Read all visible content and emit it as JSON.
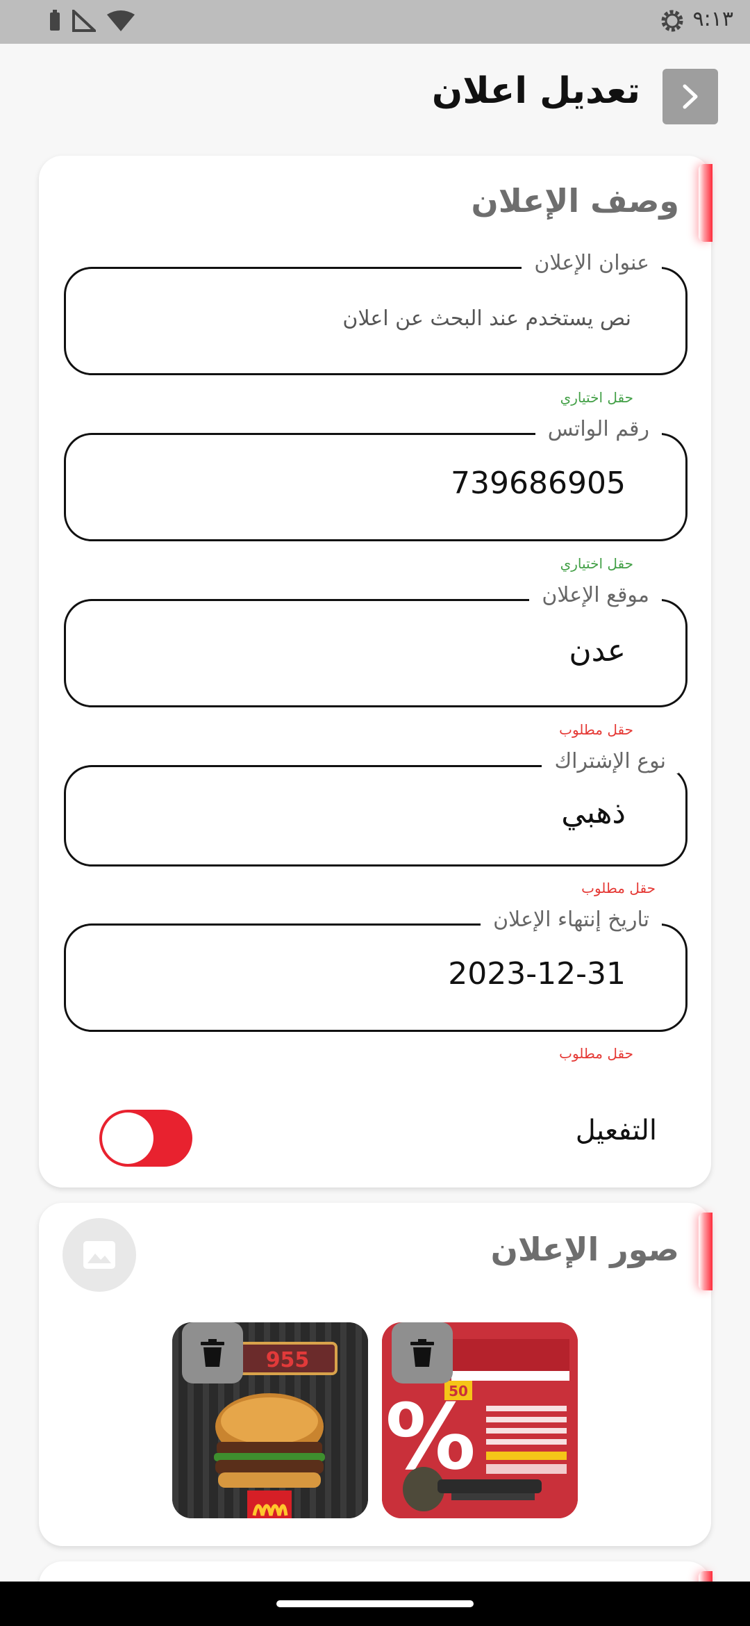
{
  "status_bar": {
    "time": "٩:١٣",
    "icons": [
      "battery-icon",
      "signal-icon",
      "wifi-icon",
      "settings-gear-icon"
    ]
  },
  "header": {
    "title": "تعديل  اعلان",
    "back_icon": "chevron-right-icon"
  },
  "ad_description": {
    "section_title": "وصف الإعلان",
    "title_field": {
      "label": "عنوان الإعلان",
      "placeholder": "نص يستخدم عند البحث عن اعلان",
      "hint": "حقل اختياري"
    },
    "whatsapp_field": {
      "label": "رقم الواتس",
      "value": "739686905",
      "hint": "حقل اختياري"
    },
    "location_field": {
      "label": "موقع الإعلان",
      "value": "عدن",
      "hint": "حقل مطلوب"
    },
    "subscription_field": {
      "label": "نوع الإشتراك",
      "value": "ذهبي",
      "hint": "حقل مطلوب"
    },
    "expiry_field": {
      "label": "تاريخ إنتهاء الإعلان",
      "value": "2023-12-31",
      "hint": "حقل مطلوب"
    },
    "activation": {
      "label": "التفعيل",
      "enabled": true
    }
  },
  "ad_images": {
    "section_title": "صور الإعلان",
    "add_icon": "image-icon",
    "images": [
      {
        "name": "burger-ad-image",
        "delete_icon": "trash-icon"
      },
      {
        "name": "discount-ad-image",
        "delete_icon": "trash-icon"
      }
    ]
  },
  "colors": {
    "accent": "#e8222f",
    "optional_hint": "#43a047",
    "required_hint": "#e53935"
  }
}
